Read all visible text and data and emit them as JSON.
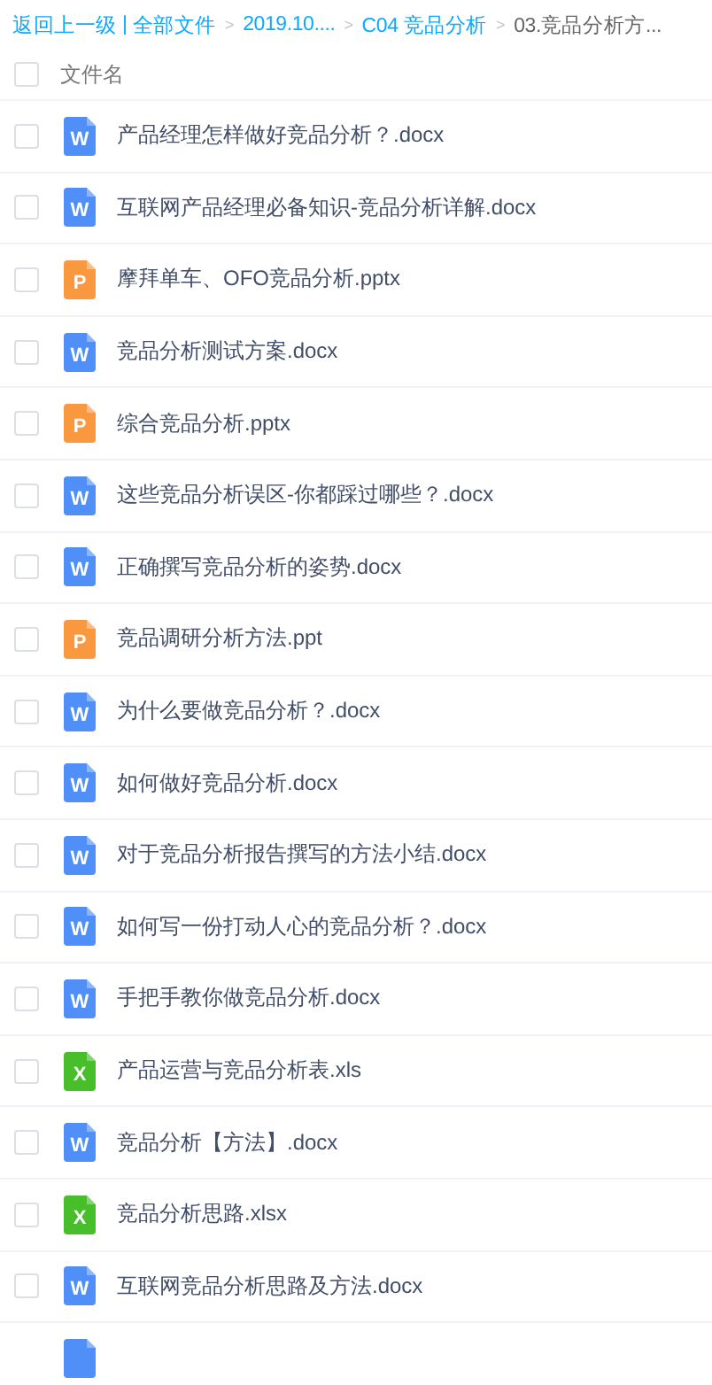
{
  "breadcrumb": {
    "back": "返回上一级",
    "divider": "|",
    "items": [
      {
        "label": "全部文件",
        "current": false
      },
      {
        "label": "2019.10....",
        "current": false
      },
      {
        "label": "C04 竞品分析",
        "current": false
      },
      {
        "label": "03.竞品分析方...",
        "current": true
      }
    ],
    "separator": ">"
  },
  "header": {
    "checked": false,
    "label": "文件名"
  },
  "files": [
    {
      "kind": "word",
      "letter": "W",
      "name": "产品经理怎样做好竞品分析？.docx",
      "checked": false
    },
    {
      "kind": "word",
      "letter": "W",
      "name": "互联网产品经理必备知识-竞品分析详解.docx",
      "checked": false
    },
    {
      "kind": "ppt",
      "letter": "P",
      "name": "摩拜单车、OFO竞品分析.pptx",
      "checked": false
    },
    {
      "kind": "word",
      "letter": "W",
      "name": "竞品分析测试方案.docx",
      "checked": false
    },
    {
      "kind": "ppt",
      "letter": "P",
      "name": "综合竞品分析.pptx",
      "checked": false
    },
    {
      "kind": "word",
      "letter": "W",
      "name": "这些竞品分析误区-你都踩过哪些？.docx",
      "checked": false
    },
    {
      "kind": "word",
      "letter": "W",
      "name": "正确撰写竞品分析的姿势.docx",
      "checked": false
    },
    {
      "kind": "ppt",
      "letter": "P",
      "name": "竞品调研分析方法.ppt",
      "checked": false
    },
    {
      "kind": "word",
      "letter": "W",
      "name": "为什么要做竞品分析？.docx",
      "checked": false
    },
    {
      "kind": "word",
      "letter": "W",
      "name": "如何做好竞品分析.docx",
      "checked": false
    },
    {
      "kind": "word",
      "letter": "W",
      "name": "对于竞品分析报告撰写的方法小结.docx",
      "checked": false
    },
    {
      "kind": "word",
      "letter": "W",
      "name": "如何写一份打动人心的竞品分析？.docx",
      "checked": false
    },
    {
      "kind": "word",
      "letter": "W",
      "name": "手把手教你做竞品分析.docx",
      "checked": false
    },
    {
      "kind": "excel",
      "letter": "X",
      "name": "产品运营与竞品分析表.xls",
      "checked": false
    },
    {
      "kind": "word",
      "letter": "W",
      "name": "竞品分析【方法】.docx",
      "checked": false
    },
    {
      "kind": "excel",
      "letter": "X",
      "name": "竞品分析思路.xlsx",
      "checked": false
    },
    {
      "kind": "word",
      "letter": "W",
      "name": "互联网竞品分析思路及方法.docx",
      "checked": false
    },
    {
      "kind": "word"
    }
  ]
}
